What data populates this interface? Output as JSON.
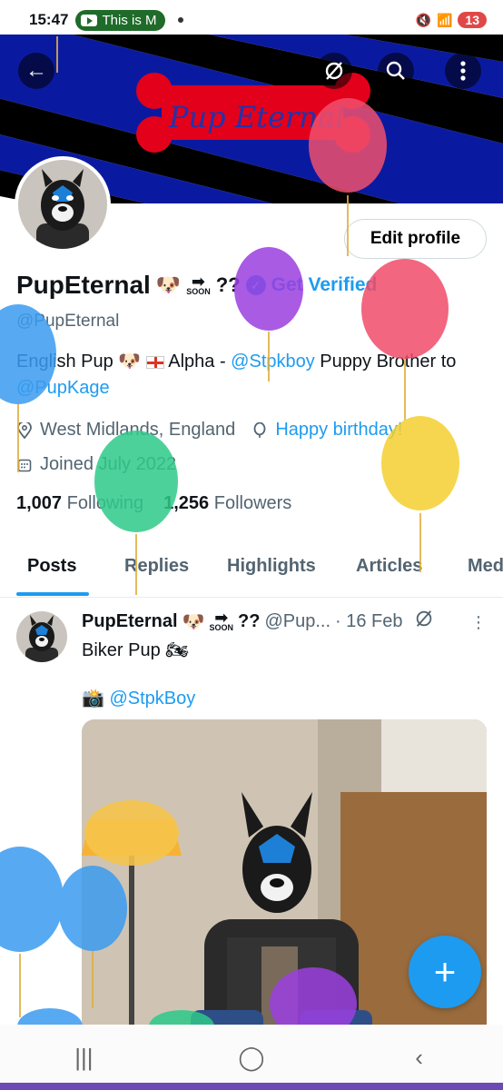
{
  "status_bar": {
    "time": "15:47",
    "notification_chip": "This is M",
    "battery": "13"
  },
  "banner": {
    "logo_text": "Pup Eternal"
  },
  "profile": {
    "edit_button": "Edit profile",
    "name": "PupEternal",
    "name_suffix": "??",
    "soon_label": "SOON",
    "get_verified": "Get Verified",
    "handle": "@PupEternal",
    "bio_part1": "English Pup",
    "bio_part2": "Alpha - ",
    "bio_link1": "@Stpkboy",
    "bio_part3": " Puppy Brother to ",
    "bio_link2": "@PupKage",
    "location": "West Midlands, England",
    "birthday": "Happy birthday!",
    "joined": "Joined July 2022",
    "following_count": "1,007",
    "following_label": "Following",
    "followers_count": "1,256",
    "followers_label": "Followers"
  },
  "tabs": [
    "Posts",
    "Replies",
    "Highlights",
    "Articles",
    "Media"
  ],
  "post": {
    "author": "PupEternal",
    "author_suffix": "??",
    "handle": "@Pup...",
    "date": "· 16 Feb",
    "text": "Biker Pup",
    "credit": "@StpkBoy"
  },
  "fab_label": "+",
  "colors": {
    "accent": "#1d9bf0",
    "text": "#0f1419",
    "muted": "#536471"
  }
}
